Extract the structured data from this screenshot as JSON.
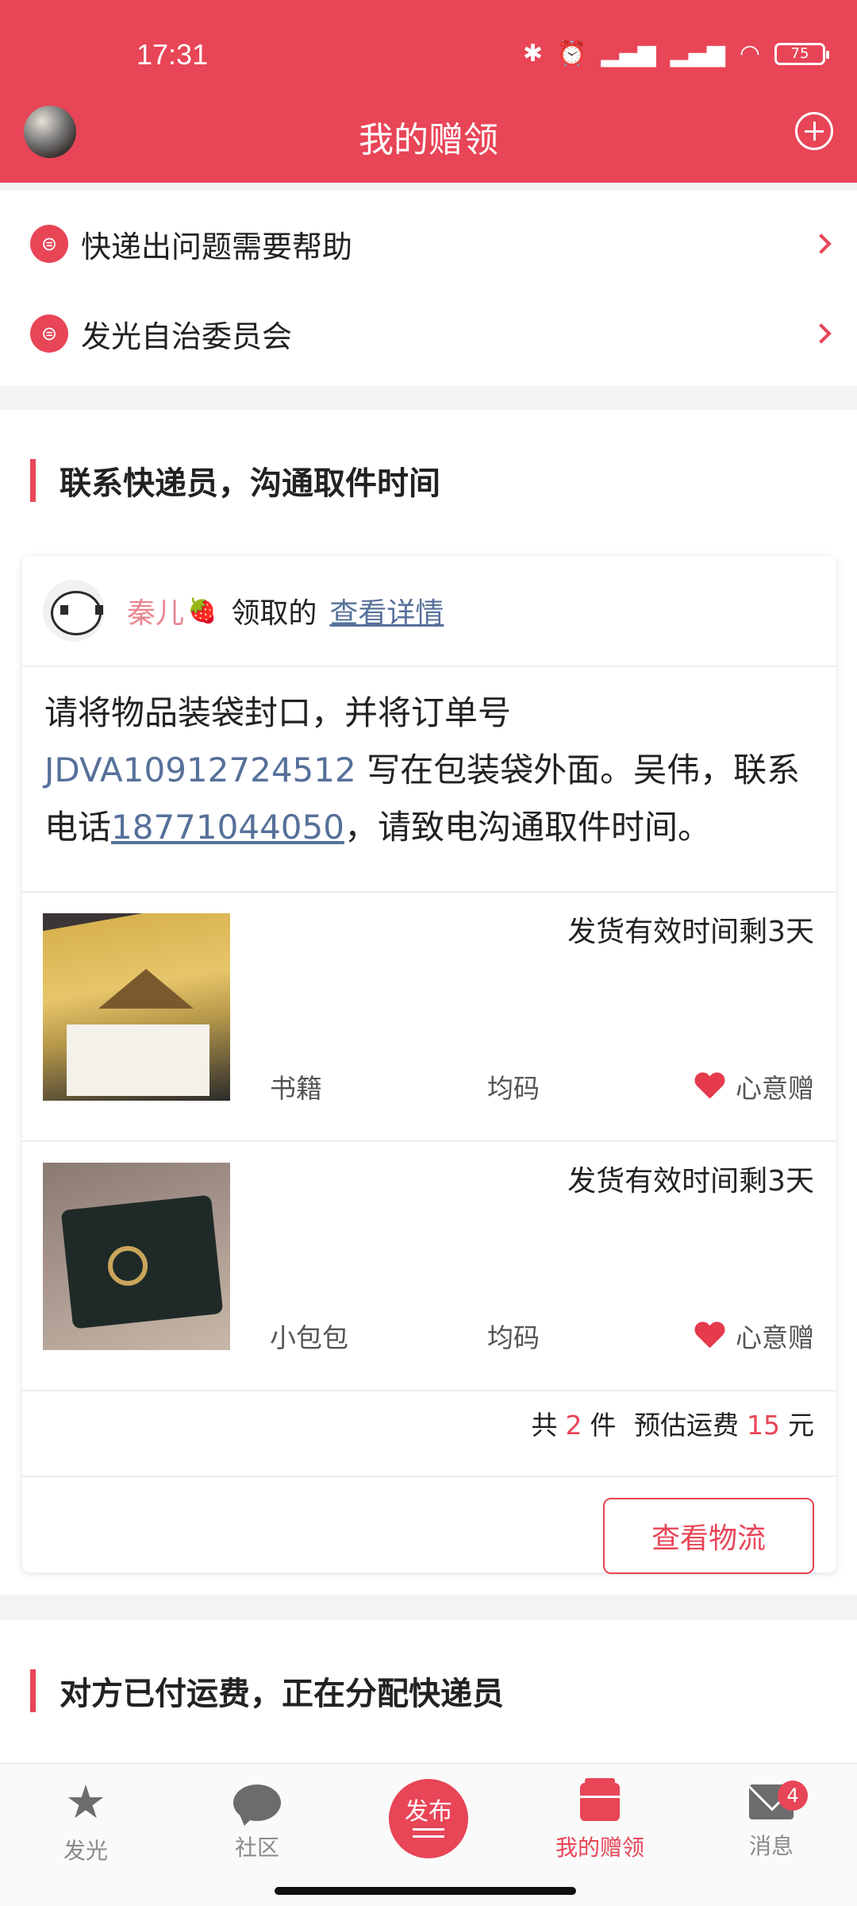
{
  "status_bar": {
    "time": "17:31",
    "battery": "75"
  },
  "header": {
    "title": "我的赠领"
  },
  "help_items": [
    {
      "label": "快递出问题需要帮助"
    },
    {
      "label": "发光自治委员会"
    }
  ],
  "section1": {
    "title": "联系快递员，沟通取件时间",
    "card": {
      "giver_name": "秦儿",
      "claimed_text": "领取的",
      "view_details": "查看详情",
      "instruction": {
        "prefix": "请将物品装袋封口，并将订单号 ",
        "order_no": "JDVA10912724512",
        "middle": " 写在包装袋外面。吴伟，联系电话",
        "phone": "18771044050",
        "suffix": "，请致电沟通取件时间。"
      },
      "items": [
        {
          "valid": "发货有效时间剩3天",
          "category": "书籍",
          "size": "均码",
          "gift_type": "心意赠"
        },
        {
          "valid": "发货有效时间剩3天",
          "category": "小包包",
          "size": "均码",
          "gift_type": "心意赠"
        }
      ],
      "summary": {
        "prefix": "共",
        "count": "2",
        "unit": "件",
        "fee_label": "预估运费",
        "fee": "15",
        "currency": "元"
      },
      "logistics_button": "查看物流"
    }
  },
  "section2": {
    "title": "对方已付运费，正在分配快递员"
  },
  "bottom_nav": {
    "items": [
      {
        "label": "发光",
        "icon": "star-icon"
      },
      {
        "label": "社区",
        "icon": "chat-icon"
      },
      {
        "label": "我的赠领",
        "icon": "gift-icon",
        "active": true
      },
      {
        "label": "消息",
        "icon": "mail-icon"
      }
    ],
    "publish": "发布",
    "message_badge": "4"
  },
  "colors": {
    "primary": "#e84557",
    "link": "#56709a"
  }
}
